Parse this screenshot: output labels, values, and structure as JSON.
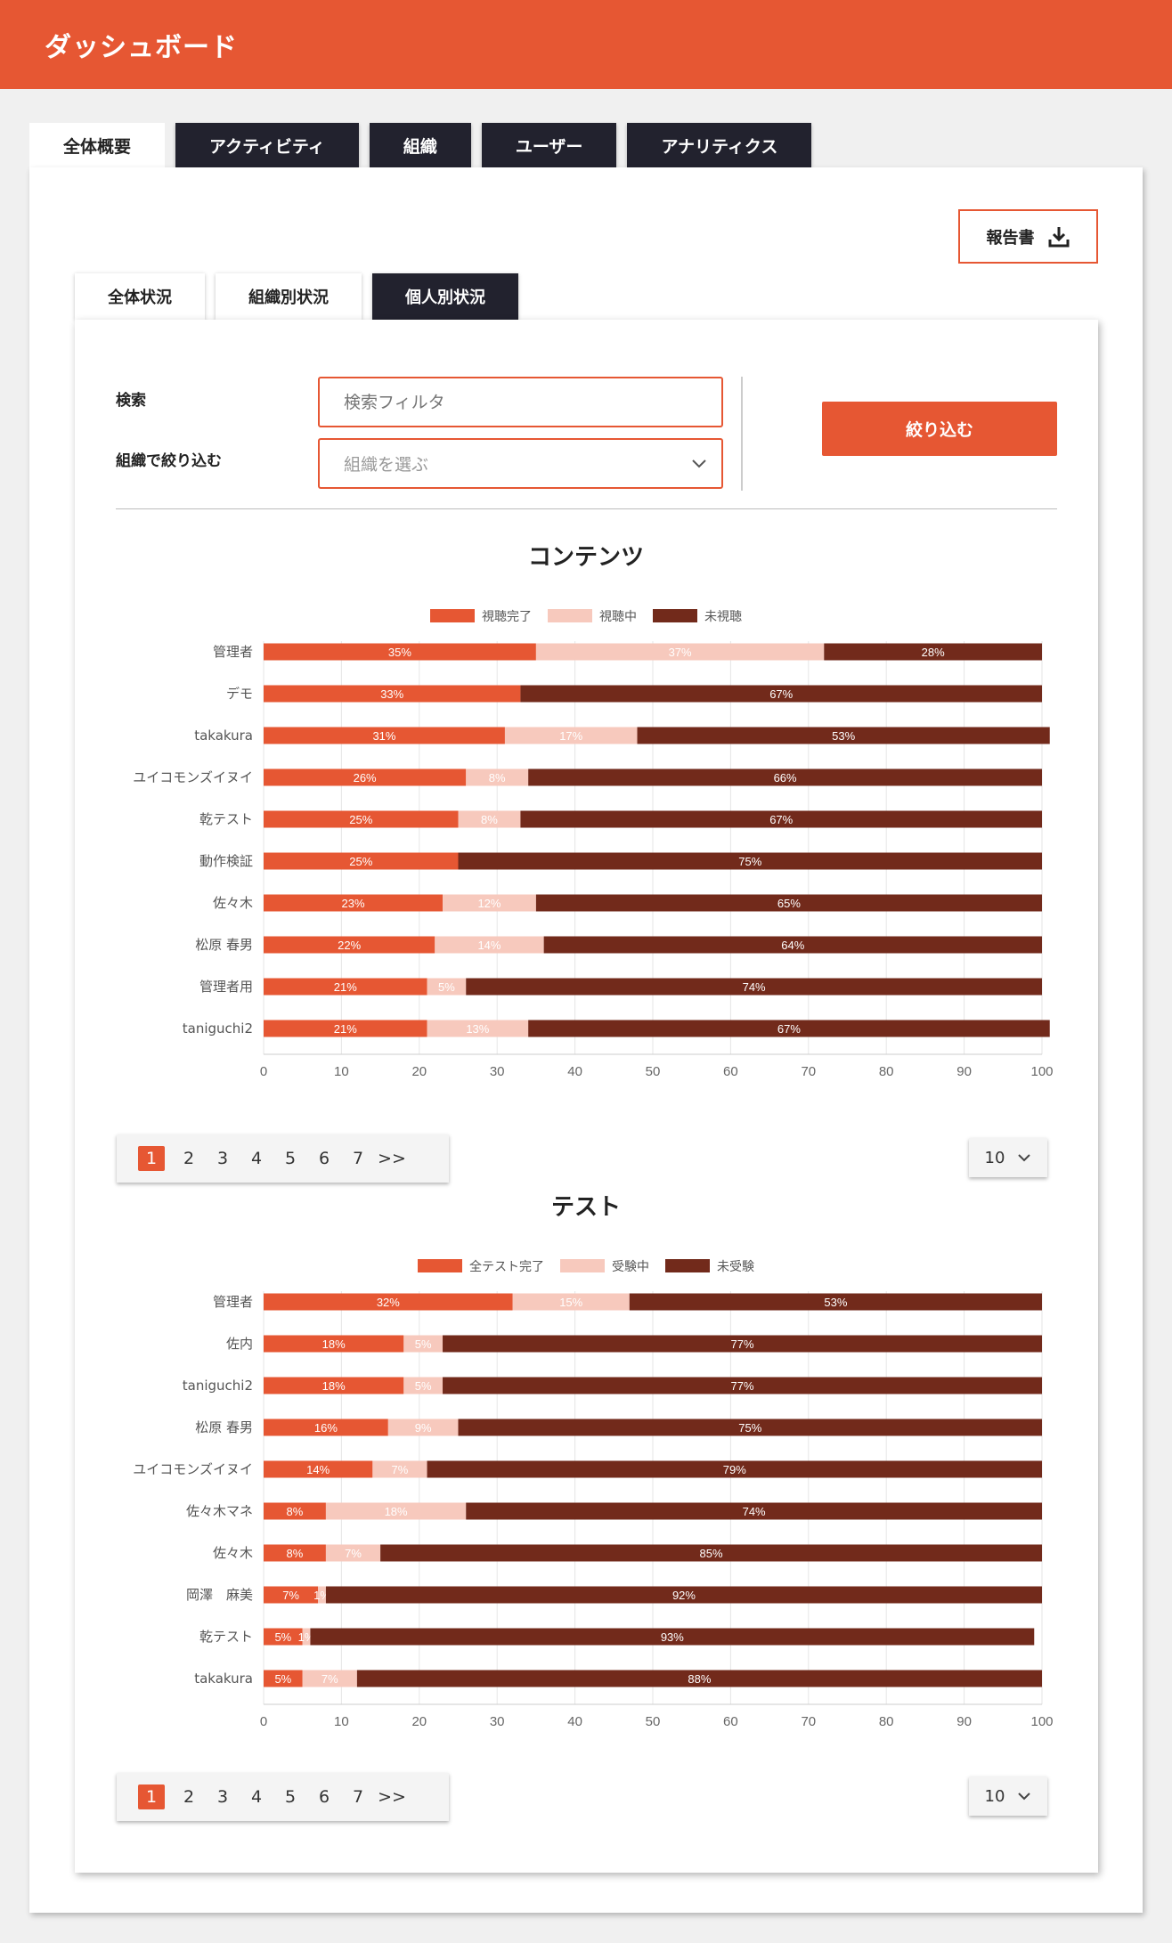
{
  "header": {
    "title": "ダッシュボード"
  },
  "main_tabs": [
    {
      "label": "全体概要",
      "active": true
    },
    {
      "label": "アクティビティ",
      "active": false
    },
    {
      "label": "組織",
      "active": false
    },
    {
      "label": "ユーザー",
      "active": false
    },
    {
      "label": "アナリティクス",
      "active": false
    }
  ],
  "report_button": {
    "label": "報告書",
    "icon": "download-icon"
  },
  "sub_tabs": [
    {
      "label": "全体状況",
      "active": false
    },
    {
      "label": "組織別状況",
      "active": false
    },
    {
      "label": "個人別状況",
      "active": true
    }
  ],
  "filters": {
    "search_label": "検索",
    "search_placeholder": "検索フィルタ",
    "org_label": "組織で絞り込む",
    "org_placeholder": "組織を選ぶ",
    "submit_label": "絞り込む"
  },
  "colors": {
    "accent": "#e65733",
    "in_progress": "#f7c9bd",
    "not_done": "#722a1b",
    "dark_tab": "#22222e"
  },
  "chart_data": [
    {
      "type": "bar",
      "orientation": "horizontal",
      "stacked": true,
      "title": "コンテンツ",
      "categories": [
        "管理者",
        "デモ",
        "takakura",
        "ユイコモンズイヌイ",
        "乾テスト",
        "動作検証",
        "佐々木",
        "松原 春男",
        "管理者用",
        "taniguchi2"
      ],
      "series": [
        {
          "name": "視聴完了",
          "color": "#e65733",
          "values": [
            35,
            33,
            31,
            26,
            25,
            25,
            23,
            22,
            21,
            21
          ]
        },
        {
          "name": "視聴中",
          "color": "#f7c9bd",
          "values": [
            37,
            0,
            17,
            8,
            8,
            0,
            12,
            14,
            5,
            13
          ]
        },
        {
          "name": "未視聴",
          "color": "#722a1b",
          "values": [
            28,
            67,
            53,
            66,
            67,
            75,
            65,
            64,
            74,
            67
          ]
        }
      ],
      "xlim": [
        0,
        100
      ],
      "xticks": [
        0,
        10,
        20,
        30,
        40,
        50,
        60,
        70,
        80,
        90,
        100
      ],
      "grid": true,
      "legend": "top-center"
    },
    {
      "type": "bar",
      "orientation": "horizontal",
      "stacked": true,
      "title": "テスト",
      "categories": [
        "管理者",
        "佐内",
        "taniguchi2",
        "松原 春男",
        "ユイコモンズイヌイ",
        "佐々木マネ",
        "佐々木",
        "岡澤　麻美",
        "乾テスト",
        "takakura"
      ],
      "series": [
        {
          "name": "全テスト完了",
          "color": "#e65733",
          "values": [
            32,
            18,
            18,
            16,
            14,
            8,
            8,
            7,
            5,
            5
          ]
        },
        {
          "name": "受験中",
          "color": "#f7c9bd",
          "values": [
            15,
            5,
            5,
            9,
            7,
            18,
            7,
            1,
            1,
            7
          ]
        },
        {
          "name": "未受験",
          "color": "#722a1b",
          "values": [
            53,
            77,
            77,
            75,
            79,
            74,
            85,
            92,
            93,
            88
          ]
        }
      ],
      "xlim": [
        0,
        100
      ],
      "xticks": [
        0,
        10,
        20,
        30,
        40,
        50,
        60,
        70,
        80,
        90,
        100
      ],
      "grid": true,
      "legend": "top-center"
    }
  ],
  "pagination": {
    "pages": [
      "1",
      "2",
      "3",
      "4",
      "5",
      "6",
      "7"
    ],
    "next": ">>",
    "active": "1",
    "per_page": "10"
  }
}
